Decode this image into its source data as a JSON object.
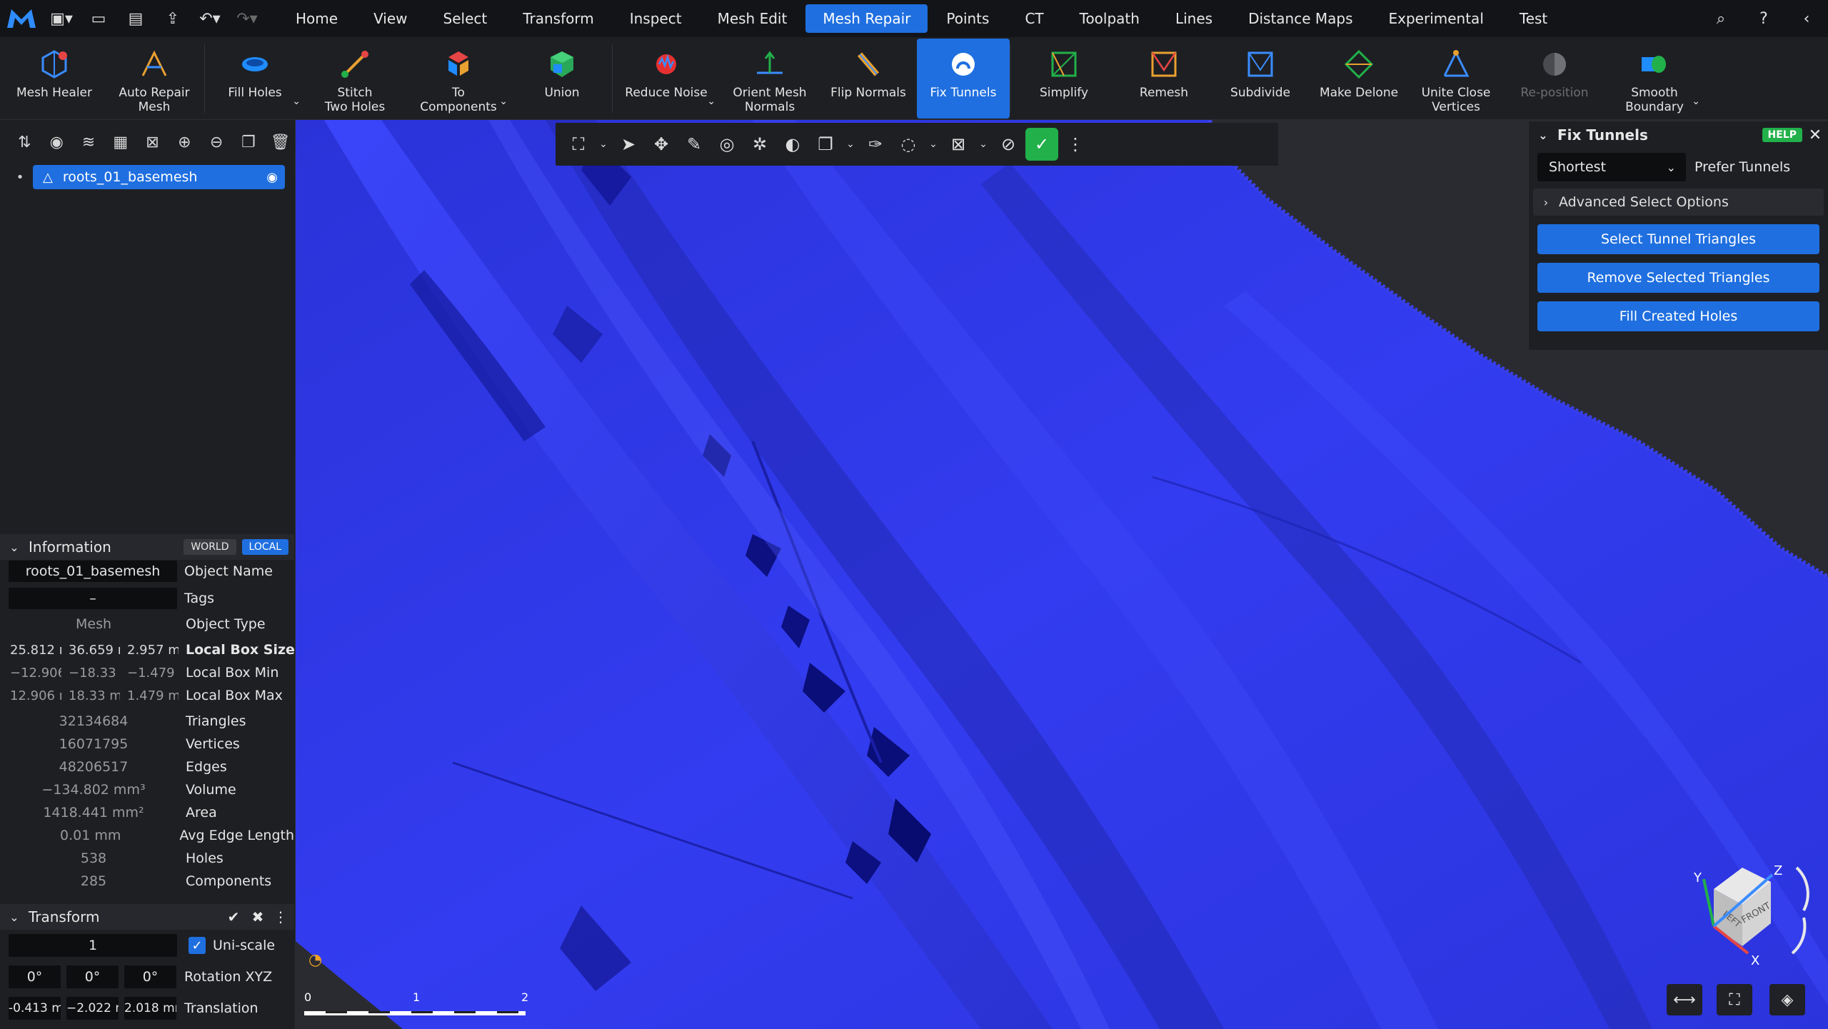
{
  "menu": {
    "tabs": [
      "Home",
      "View",
      "Select",
      "Transform",
      "Inspect",
      "Mesh Edit",
      "Mesh Repair",
      "Points",
      "CT",
      "Toolpath",
      "Lines",
      "Distance Maps",
      "Experimental",
      "Test"
    ],
    "active_tab": "Mesh Repair"
  },
  "ribbon": {
    "mesh_healer": "Mesh Healer",
    "auto_repair_1": "Auto Repair",
    "auto_repair_2": "Mesh",
    "fill_holes": "Fill Holes",
    "stitch_1": "Stitch",
    "stitch_2": "Two Holes",
    "to_components_1": "To",
    "to_components_2": "Components",
    "union": "Union",
    "reduce_noise": "Reduce Noise",
    "orient_1": "Orient Mesh",
    "orient_2": "Normals",
    "flip_normals": "Flip Normals",
    "fix_tunnels": "Fix Tunnels",
    "simplify": "Simplify",
    "remesh": "Remesh",
    "subdivide": "Subdivide",
    "make_delone": "Make Delone",
    "unite_1": "Unite Close",
    "unite_2": "Vertices",
    "reposition": "Re-position",
    "smooth_1": "Smooth",
    "smooth_2": "Boundary"
  },
  "tree": {
    "item": "roots_01_basemesh"
  },
  "information": {
    "title": "Information",
    "world": "WORLD",
    "local": "LOCAL",
    "object_name_value": "roots_01_basemesh",
    "object_name_label": "Object Name",
    "tags_value": "–",
    "tags_label": "Tags",
    "object_type_value": "Mesh",
    "object_type_label": "Object Type",
    "box_size": [
      "25.812 r",
      "36.659 r",
      "2.957 m"
    ],
    "box_size_label": "Local Box Size",
    "box_min": [
      "−12.906",
      "−18.33 r",
      "−1.479 r"
    ],
    "box_min_label": "Local Box Min",
    "box_max": [
      "12.906 r",
      "18.33 m",
      "1.479 m"
    ],
    "box_max_label": "Local Box Max",
    "triangles_value": "32134684",
    "triangles_label": "Triangles",
    "vertices_value": "16071795",
    "vertices_label": "Vertices",
    "edges_value": "48206517",
    "edges_label": "Edges",
    "volume_value": "−134.802 mm³",
    "volume_label": "Volume",
    "area_value": "1418.441 mm²",
    "area_label": "Area",
    "avg_edge_value": "0.01 mm",
    "avg_edge_label": "Avg Edge Length",
    "holes_value": "538",
    "holes_label": "Holes",
    "components_value": "285",
    "components_label": "Components"
  },
  "transform": {
    "title": "Transform",
    "scale_value": "1",
    "uniscale_label": "Uni-scale",
    "rotation": [
      "0°",
      "0°",
      "0°"
    ],
    "rotation_label": "Rotation XYZ",
    "translation": [
      "-0.413 m",
      "−2.022 m",
      "2.018 mı"
    ],
    "translation_label": "Translation"
  },
  "fix_tunnels_panel": {
    "title": "Fix Tunnels",
    "help": "HELP",
    "mode_selected": "Shortest",
    "prefer_label": "Prefer Tunnels",
    "advanced": "Advanced Select Options",
    "btn_select": "Select Tunnel Triangles",
    "btn_remove": "Remove Selected Triangles",
    "btn_fill": "Fill Created Holes"
  },
  "scale_bar": {
    "labels": [
      "0",
      "1",
      "2"
    ]
  },
  "navcube": {
    "front": "FRONT",
    "left": "LEFT",
    "x": "X",
    "y": "Y",
    "z": "Z"
  },
  "colors": {
    "accent": "#1f6fe0",
    "mesh": "#2f37e6",
    "help": "#21b04a"
  }
}
